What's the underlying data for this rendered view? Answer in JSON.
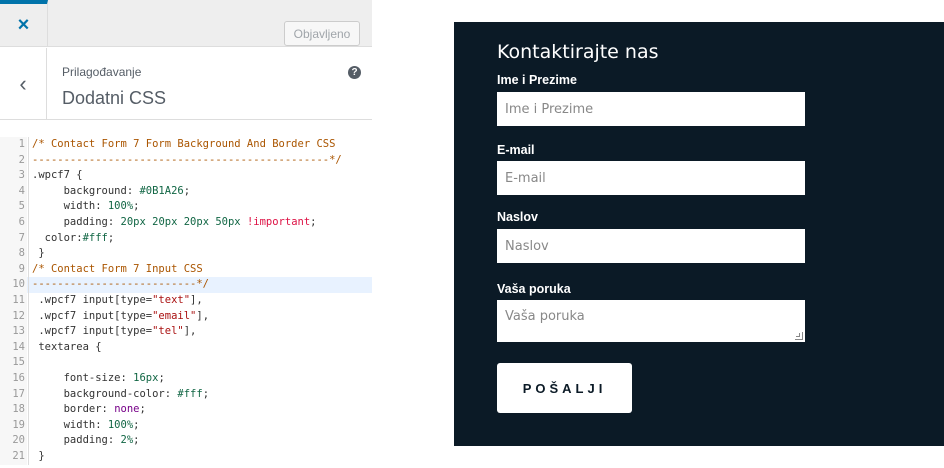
{
  "customizer": {
    "close_icon": "×",
    "publish_label": "Objavljeno",
    "back_icon": "‹",
    "breadcrumb": "Prilagođavanje",
    "section_title": "Dodatni CSS",
    "help_icon": "?"
  },
  "code_lines": [
    {
      "num": "1",
      "segments": [
        {
          "t": "/* Contact Form 7 Form Background And Border CSS",
          "c": "cm"
        }
      ]
    },
    {
      "num": "2",
      "segments": [
        {
          "t": "-----------------------------------------------*/",
          "c": "cm"
        }
      ]
    },
    {
      "num": "3",
      "segments": [
        {
          "t": ".wpcf7 {",
          "c": ""
        }
      ]
    },
    {
      "num": "4",
      "segments": [
        {
          "t": "     background: ",
          "c": ""
        },
        {
          "t": "#0B1A26",
          "c": "val"
        },
        {
          "t": ";",
          "c": ""
        }
      ]
    },
    {
      "num": "5",
      "segments": [
        {
          "t": "     width: ",
          "c": ""
        },
        {
          "t": "100%",
          "c": "val"
        },
        {
          "t": ";",
          "c": ""
        }
      ]
    },
    {
      "num": "6",
      "segments": [
        {
          "t": "     padding: ",
          "c": ""
        },
        {
          "t": "20px 20px 20px 50px",
          "c": "val"
        },
        {
          "t": " ",
          "c": ""
        },
        {
          "t": "!important",
          "c": "imp"
        },
        {
          "t": ";",
          "c": ""
        }
      ]
    },
    {
      "num": "7",
      "segments": [
        {
          "t": "  color:",
          "c": ""
        },
        {
          "t": "#fff",
          "c": "val"
        },
        {
          "t": ";",
          "c": ""
        }
      ]
    },
    {
      "num": "8",
      "segments": [
        {
          "t": " }",
          "c": ""
        }
      ]
    },
    {
      "num": "9",
      "segments": [
        {
          "t": "/* Contact Form 7 Input CSS",
          "c": "cm"
        }
      ]
    },
    {
      "num": "10",
      "segments": [
        {
          "t": "--------------------------*/",
          "c": "cm"
        }
      ],
      "active": true
    },
    {
      "num": "11",
      "segments": [
        {
          "t": " .wpcf7 input[type=",
          "c": ""
        },
        {
          "t": "\"text\"",
          "c": "str"
        },
        {
          "t": "],",
          "c": ""
        }
      ]
    },
    {
      "num": "12",
      "segments": [
        {
          "t": " .wpcf7 input[type=",
          "c": ""
        },
        {
          "t": "\"email\"",
          "c": "str"
        },
        {
          "t": "],",
          "c": ""
        }
      ]
    },
    {
      "num": "13",
      "segments": [
        {
          "t": " .wpcf7 input[type=",
          "c": ""
        },
        {
          "t": "\"tel\"",
          "c": "str"
        },
        {
          "t": "],",
          "c": ""
        }
      ]
    },
    {
      "num": "14",
      "segments": [
        {
          "t": " textarea {",
          "c": ""
        }
      ]
    },
    {
      "num": "15",
      "segments": [
        {
          "t": "",
          "c": ""
        }
      ]
    },
    {
      "num": "16",
      "segments": [
        {
          "t": "     font-size: ",
          "c": ""
        },
        {
          "t": "16px",
          "c": "val"
        },
        {
          "t": ";",
          "c": ""
        }
      ]
    },
    {
      "num": "17",
      "segments": [
        {
          "t": "     background-color: ",
          "c": ""
        },
        {
          "t": "#fff",
          "c": "val"
        },
        {
          "t": ";",
          "c": ""
        }
      ]
    },
    {
      "num": "18",
      "segments": [
        {
          "t": "     border: ",
          "c": ""
        },
        {
          "t": "none",
          "c": "kw"
        },
        {
          "t": ";",
          "c": ""
        }
      ]
    },
    {
      "num": "19",
      "segments": [
        {
          "t": "     width: ",
          "c": ""
        },
        {
          "t": "100%",
          "c": "val"
        },
        {
          "t": ";",
          "c": ""
        }
      ]
    },
    {
      "num": "20",
      "segments": [
        {
          "t": "     padding: ",
          "c": ""
        },
        {
          "t": "2%",
          "c": "val"
        },
        {
          "t": ";",
          "c": ""
        }
      ]
    },
    {
      "num": "21",
      "segments": [
        {
          "t": " }",
          "c": ""
        }
      ]
    }
  ],
  "form": {
    "title": "Kontaktirajte nas",
    "name_label": "Ime i Prezime",
    "name_placeholder": "Ime i Prezime",
    "email_label": "E-mail",
    "email_placeholder": "E-mail",
    "subject_label": "Naslov",
    "subject_placeholder": "Naslov",
    "message_label": "Vaša poruka",
    "message_placeholder": "Vaša poruka",
    "submit_label": "POŠALJI"
  },
  "colors": {
    "form_background": "#0B1A26",
    "accent": "#0073aa"
  }
}
